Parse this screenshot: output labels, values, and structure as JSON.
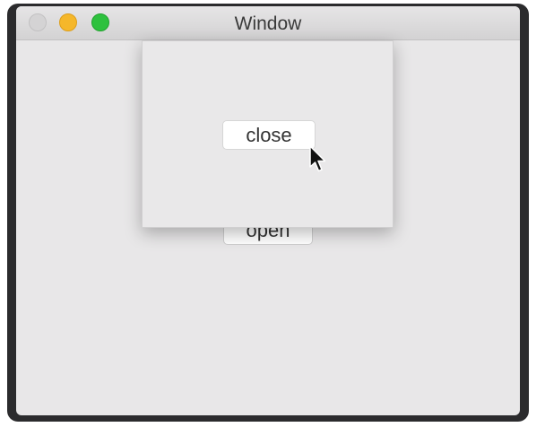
{
  "window": {
    "title": "Window",
    "traffic_lights": [
      "close-light",
      "minimize-light",
      "zoom-light"
    ]
  },
  "main": {
    "open_label": "open"
  },
  "sheet": {
    "close_label": "close"
  },
  "colors": {
    "minimize": "#f5b72a",
    "zoom": "#2ec13e",
    "close_inactive": "#d4d3d4"
  },
  "icons": {
    "cursor": "arrow-cursor-icon"
  }
}
